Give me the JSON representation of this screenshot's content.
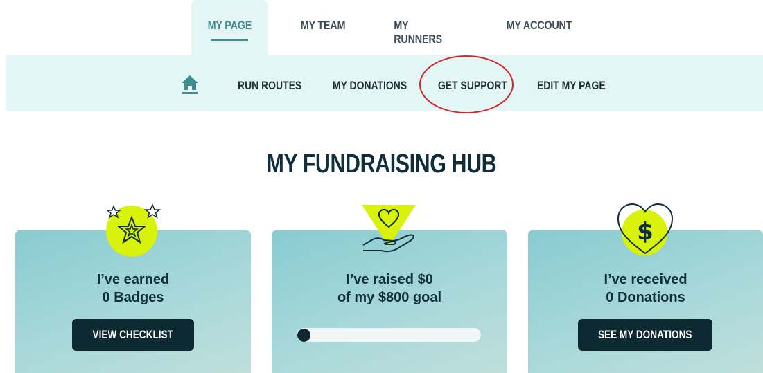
{
  "top_tabs": [
    {
      "label": "MY PAGE",
      "active": true
    },
    {
      "label": "MY TEAM",
      "active": false
    },
    {
      "label": "MY RUNNERS",
      "active": false
    },
    {
      "label": "MY ACCOUNT",
      "active": false
    }
  ],
  "subnav": {
    "items": [
      {
        "label": "RUN ROUTES"
      },
      {
        "label": "MY DONATIONS"
      },
      {
        "label": "GET SUPPORT"
      },
      {
        "label": "EDIT MY PAGE"
      }
    ],
    "home_icon": "home-icon"
  },
  "hub": {
    "title": "MY FUNDRAISING HUB"
  },
  "cards": {
    "badges": {
      "line1": "I’ve earned",
      "line2": "0 Badges",
      "button": "VIEW CHECKLIST",
      "icon": "stars-icon"
    },
    "raised": {
      "line1": "I’ve raised $0",
      "line2": "of my $800 goal",
      "progress": 0,
      "icon": "heart-hand-icon"
    },
    "donations": {
      "line1": "I’ve received",
      "line2": "0 Donations",
      "button": "SEE MY DONATIONS",
      "icon": "heart-dollar-icon"
    }
  },
  "colors": {
    "accent": "#3e8d8f",
    "lime": "#d9f20b",
    "dark": "#0d2a33",
    "annotation": "#d62728"
  }
}
